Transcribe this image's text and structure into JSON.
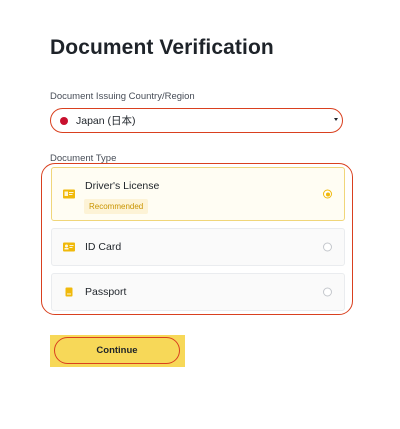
{
  "page": {
    "title": "Document Verification"
  },
  "country": {
    "label": "Document Issuing Country/Region",
    "value": "Japan (日本)",
    "flag_icon": "japan-flag-icon",
    "flag_color": "#c8102e",
    "caret_icon": "caret-down-icon"
  },
  "document_type": {
    "label": "Document Type",
    "options": [
      {
        "name": "Driver's License",
        "badge": "Recommended",
        "icon": "drivers-license-icon",
        "selected": true
      },
      {
        "name": "ID Card",
        "icon": "id-card-icon",
        "selected": false
      },
      {
        "name": "Passport",
        "icon": "passport-icon",
        "selected": false
      }
    ]
  },
  "actions": {
    "continue_label": "Continue"
  },
  "colors": {
    "accent": "#f0b90b",
    "button": "#f7d858",
    "highlight": "#d9401f"
  }
}
